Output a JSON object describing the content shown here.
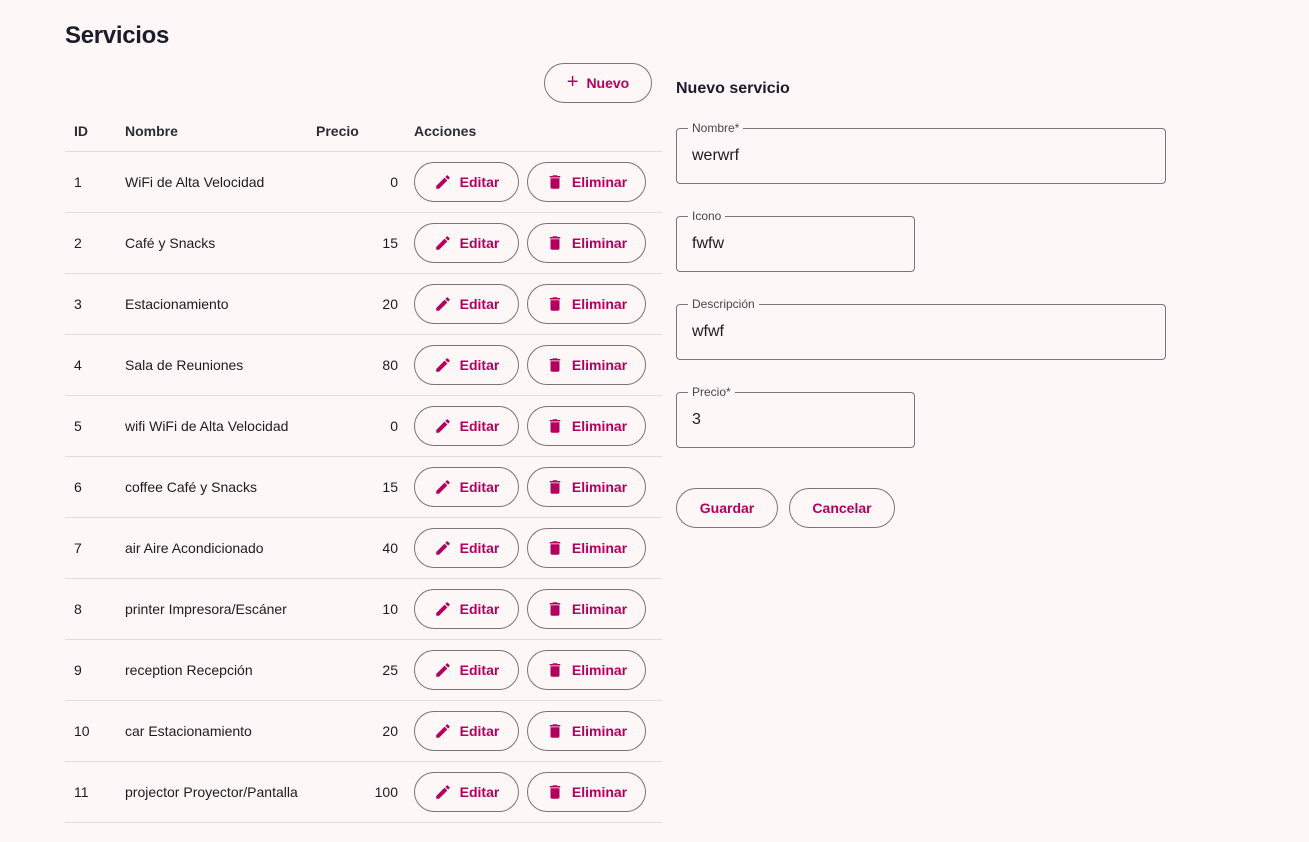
{
  "page": {
    "title": "Servicios"
  },
  "toolbar": {
    "new_label": "Nuevo"
  },
  "table": {
    "headers": {
      "id": "ID",
      "name": "Nombre",
      "price": "Precio",
      "actions": "Acciones"
    },
    "edit_label": "Editar",
    "delete_label": "Eliminar",
    "rows": [
      {
        "id": "1",
        "name": "WiFi de Alta Velocidad",
        "price": "0"
      },
      {
        "id": "2",
        "name": "Café y Snacks",
        "price": "15"
      },
      {
        "id": "3",
        "name": "Estacionamiento",
        "price": "20"
      },
      {
        "id": "4",
        "name": "Sala de Reuniones",
        "price": "80"
      },
      {
        "id": "5",
        "name": "wifi WiFi de Alta Velocidad",
        "price": "0"
      },
      {
        "id": "6",
        "name": "coffee Café y Snacks",
        "price": "15"
      },
      {
        "id": "7",
        "name": "air Aire Acondicionado",
        "price": "40"
      },
      {
        "id": "8",
        "name": "printer Impresora/Escáner",
        "price": "10"
      },
      {
        "id": "9",
        "name": "reception Recepción",
        "price": "25"
      },
      {
        "id": "10",
        "name": "car Estacionamiento",
        "price": "20"
      },
      {
        "id": "11",
        "name": "projector Proyector/Pantalla",
        "price": "100"
      }
    ]
  },
  "form": {
    "title": "Nuevo servicio",
    "fields": {
      "name": {
        "label": "Nombre*",
        "value": "werwrf"
      },
      "icon": {
        "label": "Icono",
        "value": "fwfw"
      },
      "description": {
        "label": "Descripción",
        "value": "wfwf"
      },
      "price": {
        "label": "Precio*",
        "value": "3"
      }
    },
    "save_label": "Guardar",
    "cancel_label": "Cancelar"
  },
  "colors": {
    "accent": "#b3005e",
    "background": "#fef7f7",
    "outline": "#79747e"
  },
  "icons": {
    "new": "plus-icon",
    "edit": "pencil-icon",
    "delete": "trash-icon"
  }
}
